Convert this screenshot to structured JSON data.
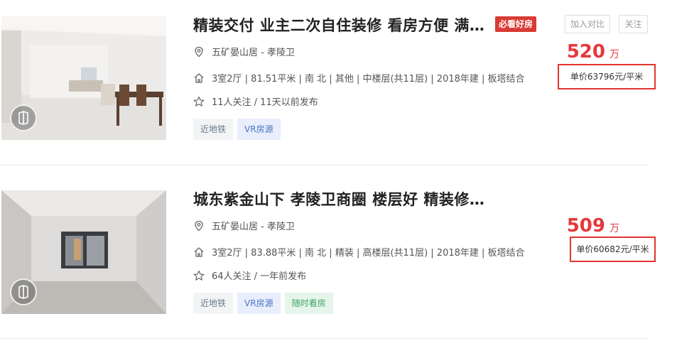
{
  "listings": [
    {
      "title": "精装交付 业主二次自住装修 看房方便 满…",
      "badge": "必看好房",
      "compare_label": "加入对比",
      "follow_label": "关注",
      "location": "五矿晏山居 - 孝陵卫",
      "info": "3室2厅 | 81.51平米 | 南 北 | 其他 | 中楼层(共11层) | 2018年建 | 板塔结合",
      "followers": "11人关注 / 11天以前发布",
      "tags": [
        "近地铁",
        "VR房源"
      ],
      "total_price": "520",
      "total_unit": "万",
      "unit_price": "单价63796元/平米"
    },
    {
      "title": "城东紫金山下 孝陵卫商圈 楼层好 精装修…",
      "location": "五矿晏山居 - 孝陵卫",
      "info": "3室2厅 | 83.88平米 | 南 北 | 精装 | 高楼层(共11层) | 2018年建 | 板塔结合",
      "followers": "64人关注 / 一年前发布",
      "tags": [
        "近地铁",
        "VR房源",
        "随时看房"
      ],
      "total_price": "509",
      "total_unit": "万",
      "unit_price": "单价60682元/平米"
    }
  ],
  "icons": {
    "location": "location-pin-icon",
    "house": "house-icon",
    "star": "star-icon",
    "vr": "vr-icon"
  },
  "colors": {
    "price": "#e4393c",
    "highlight_box": "#e0352f",
    "badge": "#d93a34"
  }
}
